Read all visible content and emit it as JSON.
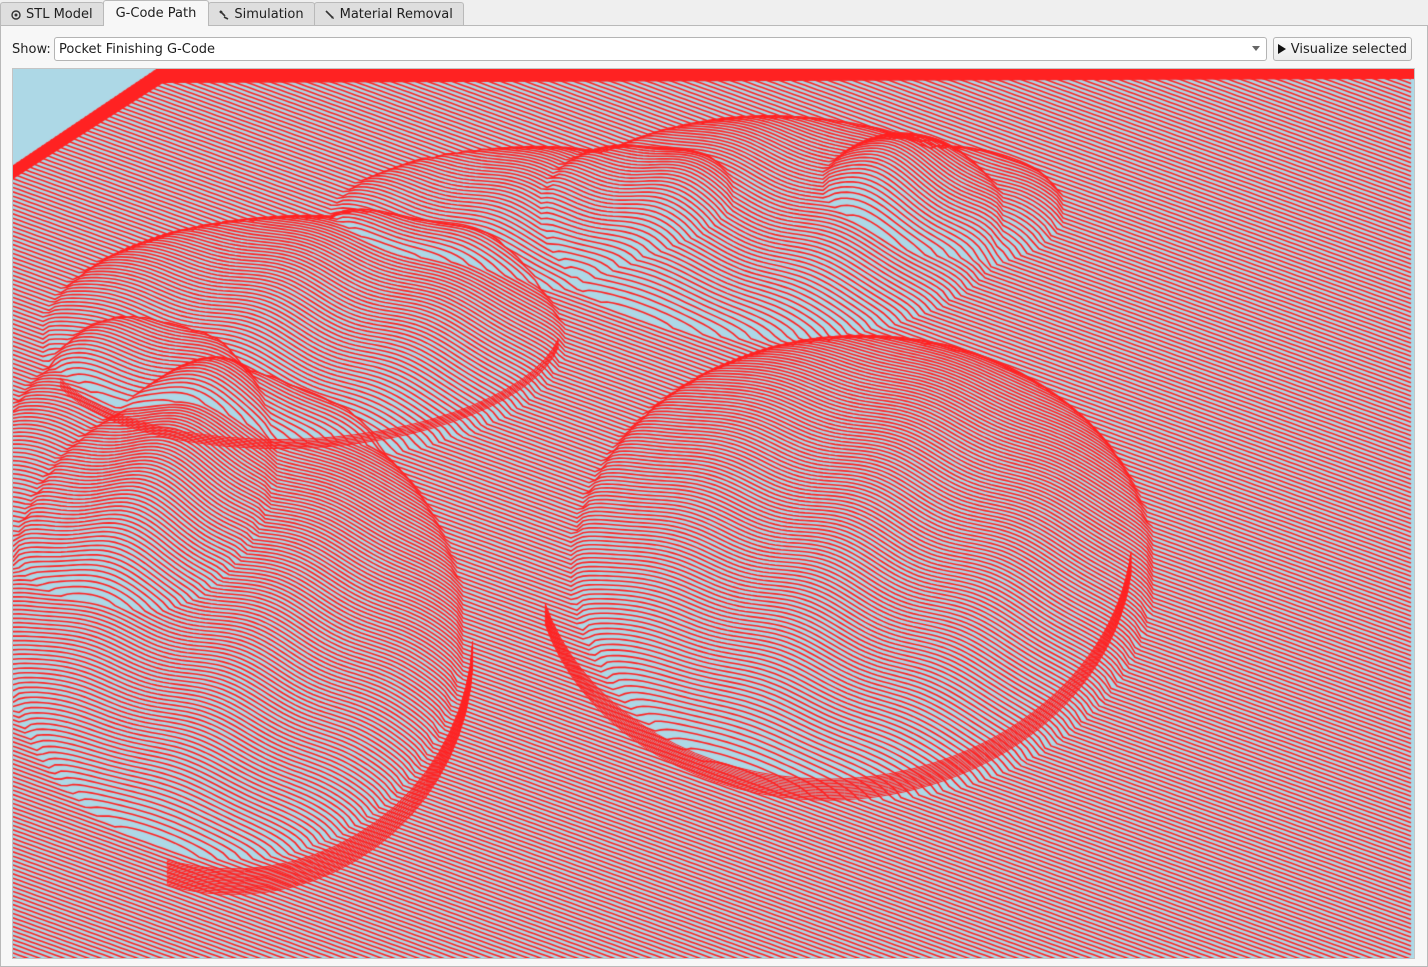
{
  "tabs": [
    {
      "label": "STL Model",
      "icon": "stl-model-icon",
      "active": false
    },
    {
      "label": "G-Code Path",
      "icon": "",
      "active": true
    },
    {
      "label": "Simulation",
      "icon": "simulation-tool-icon",
      "active": false
    },
    {
      "label": "Material Removal",
      "icon": "material-removal-icon",
      "active": false
    }
  ],
  "toolbar": {
    "show_label": "Show:",
    "selected_gcode": "Pocket Finishing G-Code",
    "visualize_label": "Visualize selected"
  },
  "colors": {
    "toolpath": "#ff2222",
    "background": "#add8e6"
  }
}
